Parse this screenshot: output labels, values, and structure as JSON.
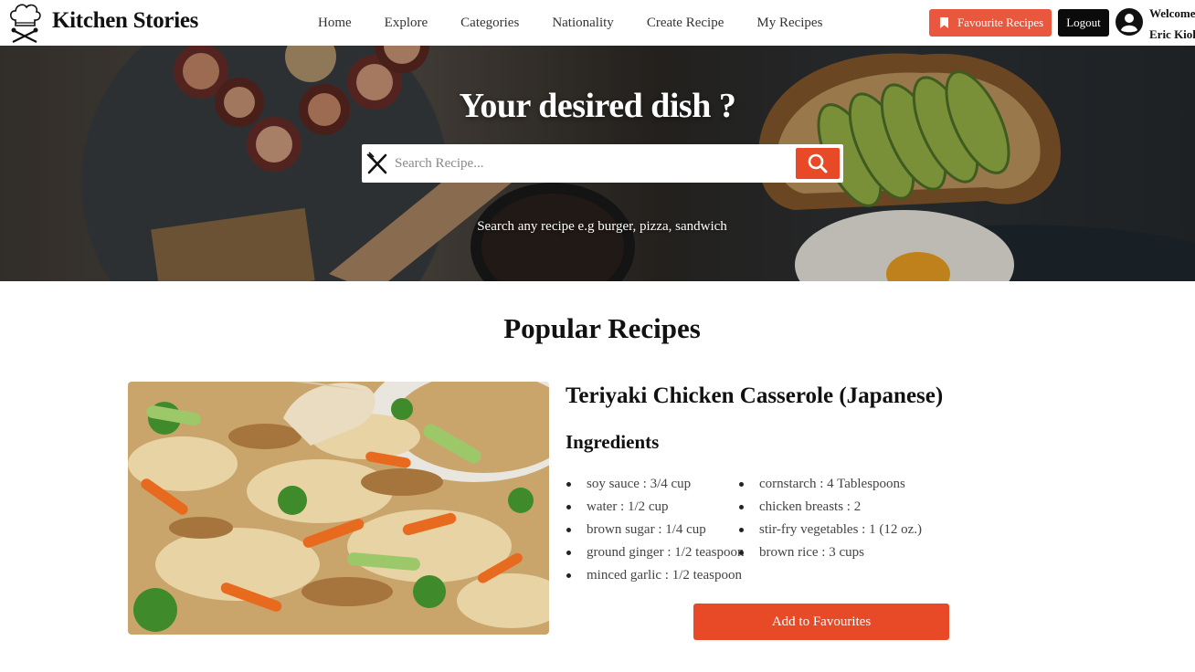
{
  "navbar": {
    "brand": "Kitchen Stories",
    "links": [
      "Home",
      "Explore",
      "Categories",
      "Nationality",
      "Create Recipe",
      "My Recipes"
    ],
    "favourites_label": "Favourite Recipes",
    "logout_label": "Logout",
    "welcome_line1": "Welcome",
    "welcome_line2": "Eric Kiok"
  },
  "hero": {
    "title": "Your desired dish ?",
    "search_placeholder": "Search Recipe...",
    "hint": "Search any recipe e.g burger, pizza, sandwich"
  },
  "popular": {
    "heading": "Popular Recipes",
    "recipe": {
      "title": "Teriyaki Chicken Casserole (Japanese)",
      "ingredients_heading": "Ingredients",
      "ingredients_col1": [
        "soy sauce : 3/4 cup",
        "water : 1/2 cup",
        "brown sugar : 1/4 cup",
        "ground ginger : 1/2 teaspoon",
        "minced garlic : 1/2 teaspoon"
      ],
      "ingredients_col2": [
        "cornstarch : 4 Tablespoons",
        "chicken breasts : 2",
        "stir-fry vegetables : 1 (12 oz.)",
        "brown rice : 3 cups"
      ],
      "add_button": "Add to Favourites"
    }
  },
  "colors": {
    "accent": "#e84a27",
    "favourites_button": "#e9573f",
    "logout_button": "#0b0b0b"
  },
  "icons": {
    "logo": "chef-hat-icon",
    "bookmark": "bookmark-icon",
    "avatar": "user-circle-icon",
    "search": "search-icon",
    "utensils": "fork-knife-icon"
  }
}
